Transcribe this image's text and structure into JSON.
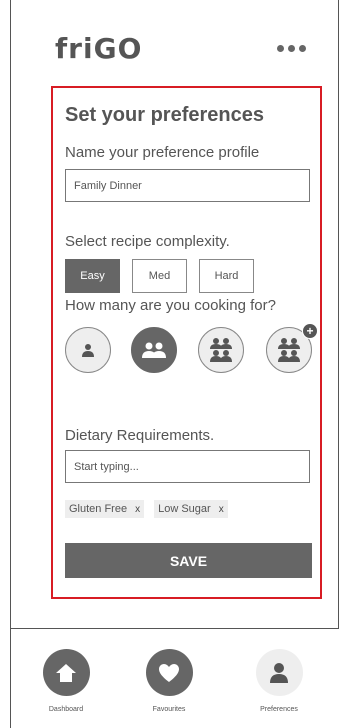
{
  "app": {
    "logo": "friGO"
  },
  "preferences": {
    "title": "Set your preferences",
    "profile_label": "Name your preference profile",
    "profile_value": "Family Dinner",
    "complexity_label": "Select recipe complexity.",
    "complexity_options": [
      "Easy",
      "Med",
      "Hard"
    ],
    "complexity_selected": "Easy",
    "cooking_for_label": "How many are you cooking for?",
    "cooking_for_options": [
      "one-person-icon",
      "two-people-icon",
      "four-people-icon",
      "four-plus-people-icon"
    ],
    "cooking_for_selected_index": 1,
    "dietary_label": "Dietary Requirements.",
    "dietary_placeholder": "Start typing...",
    "dietary_tags": [
      {
        "label": "Gluten Free",
        "remove": "x"
      },
      {
        "label": "Low Sugar",
        "remove": "x"
      }
    ],
    "save_label": "SAVE"
  },
  "nav": {
    "items": [
      {
        "label": "Dashboard",
        "icon": "home-icon"
      },
      {
        "label": "Favourites",
        "icon": "heart-icon"
      },
      {
        "label": "Preferences",
        "icon": "person-icon"
      }
    ],
    "active": "Preferences"
  },
  "colors": {
    "highlight_border": "#d81c24",
    "primary_gray": "#666666",
    "light_gray": "#eeeeee"
  }
}
